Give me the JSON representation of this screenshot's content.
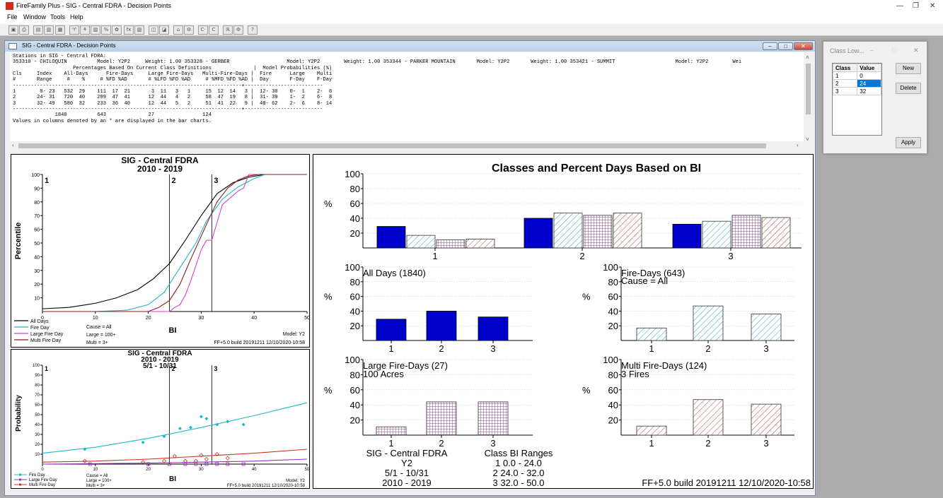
{
  "app": {
    "title": "FireFamily Plus - SIG - Central FDRA - Decision Points",
    "menu": [
      "File",
      "Window",
      "Tools",
      "Help"
    ],
    "toolbar_icons": [
      "save-icon",
      "print-icon",
      "export-icon",
      "copy-icon",
      "view-icon",
      "fire-icon",
      "chart-icon",
      "percent-icon",
      "weather-icon",
      "fx-icon",
      "table-icon",
      "bar-icon",
      "line-icon",
      "map-icon",
      "settings-icon",
      "class-icon",
      "class-edit-icon",
      "range-icon",
      "decision-icon",
      "decision-edit-icon",
      "help-icon"
    ],
    "toolbar_glyphs": [
      "▣",
      "⎙",
      "▤",
      "▥",
      "▦",
      "♈",
      "⚘",
      "▧",
      "%",
      "✿",
      "fx",
      "▨",
      "◫",
      "◪",
      "⌂",
      "⚙",
      "C·",
      "C",
      "ℝ",
      "Ф",
      "?"
    ]
  },
  "window": {
    "title": "SIG - Central FDRA - Decision Points",
    "controls": [
      "–",
      "□",
      "✕"
    ]
  },
  "report": {
    "lines": [
      "Stations in SIG - Central FDRA:",
      "353310 - CHILOQUIN          Model: Y2P2     Weight: 1.00 353328 - GERBER                   Model: Y2P2        Weight: 1.00 353344 - PARKER MOUNTAIN       Model: Y2P2       Weight: 1.00 353421 - SUMMIT                    Model: Y2P2        Wei",
      "                    Percentages Based On Current Class Definitions              |  Model Probabilities (%)",
      "Cls     Index    All-Days      Fire-Days     Large Fire-Days   Multi-Fire-Days |  Fire      Large    Multi",
      "#       Range     #    %     # %FD %AD       # %LFD %FD %AD     # %MFD %FD %AD |  Day       F-Day    F-Day",
      "----------------------------------------------------------------------------+--------------------------",
      "1        0- 23   532  29    111  17  21       3  11   3   1     15  12  14   3 |  12- 30    0-  1    2-  6",
      "2       24- 31   720  40    299  47  41      12  44   4   2     58  47  19   8 |  31- 39    1-  2    6-  8",
      "3       32- 49   580  32    233  36  40      12  44   5   2     51  41  22   9 |  40- 62    2-  6    8- 14",
      "----------------------------------------------------------------------------+--------------------------",
      "              1840          643              27                124",
      "Values in columns denoted by an * are displayed in the bar charts."
    ]
  },
  "percentile_chart": {
    "title": "SIG - Central FDRA",
    "subtitle": "2010 - 2019",
    "xlabel": "BI",
    "ylabel": "Percentile",
    "xticks": [
      "0",
      "10",
      "20",
      "30",
      "40",
      "50"
    ],
    "yticks": [
      "10",
      "20",
      "30",
      "40",
      "50",
      "60",
      "70",
      "80",
      "90",
      "100"
    ],
    "legend": [
      "All Days",
      "Fire Day",
      "Large Fire Day",
      "Multi Fire Day"
    ],
    "notes": [
      "Cause = All",
      "Large = 100+",
      "Multi = 3+"
    ],
    "model": "Model: Y2",
    "build": "FF+5.0 build 20191211 12/10/2020-10:58",
    "class_lines": [
      {
        "bi": 0,
        "label": "1"
      },
      {
        "bi": 24,
        "label": "2"
      },
      {
        "bi": 32,
        "label": "3"
      }
    ]
  },
  "probability_chart": {
    "title": "SIG - Central FDRA",
    "subtitle": "2010 - 2019",
    "period": "5/1 - 10/31",
    "xlabel": "BI",
    "ylabel": "Probability",
    "xticks": [
      "0",
      "10",
      "20",
      "30",
      "40",
      "50"
    ],
    "yticks": [
      "10",
      "20",
      "30",
      "40",
      "50",
      "60",
      "70",
      "80",
      "90",
      "100"
    ],
    "legend": [
      "Fire Day",
      "Large Fire Day",
      "Multi Fire Day"
    ],
    "notes": [
      "Cause = All",
      "Large = 100+",
      "Multi = 3+"
    ],
    "model": "Model: Y2",
    "build": "FF+5.0 build 20191211 12/10/2020-10:58"
  },
  "bar_panel": {
    "title": "Classes and Percent Days Based on BI",
    "pct": "%",
    "yticks": [
      "20",
      "40",
      "60",
      "80",
      "100"
    ],
    "classes": [
      "1",
      "2",
      "3"
    ],
    "subtitles": {
      "all": "All Days (1840)",
      "fire": "Fire-Days (643)",
      "fire2": "Cause = All",
      "large": "Large Fire-Days (27)",
      "large2": "100 Acres",
      "multi": "Multi Fire-Days (124)",
      "multi2": "3 Fires"
    },
    "footer": {
      "area": "SIG - Central FDRA",
      "model": "Y2",
      "period": "5/1 - 10/31",
      "years": "2010 - 2019",
      "ranges_title": "Class BI Ranges",
      "ranges": [
        "1  0.0 -  24.0",
        "2  24.0 -  32.0",
        "3  32.0 -  50.0"
      ],
      "build": "FF+5.0 build 20191211 12/10/2020-10:58"
    }
  },
  "class_window": {
    "title": "Class Low...",
    "controls": [
      "–",
      "□",
      "✕"
    ],
    "headers": [
      "Class",
      "Value"
    ],
    "rows": [
      [
        "1",
        "0"
      ],
      [
        "2",
        "24"
      ],
      [
        "3",
        "32"
      ]
    ],
    "buttons": {
      "new": "New",
      "delete": "Delete",
      "apply": "Apply"
    }
  },
  "chart_data": [
    {
      "type": "line",
      "title": "SIG - Central FDRA",
      "xlabel": "BI",
      "ylabel": "Percentile",
      "xlim": [
        0,
        50
      ],
      "ylim": [
        0,
        100
      ],
      "series": [
        {
          "name": "All Days",
          "color": "#000000",
          "x": [
            0,
            5,
            10,
            14,
            18,
            21,
            24,
            27,
            30,
            33,
            36,
            39,
            42,
            45,
            50
          ],
          "y": [
            2,
            3,
            6,
            10,
            16,
            24,
            35,
            52,
            70,
            86,
            94,
            98,
            100,
            100,
            100
          ]
        },
        {
          "name": "Fire Day",
          "color": "#1fb7c9",
          "x": [
            0,
            10,
            16,
            20,
            23,
            26,
            29,
            31,
            34,
            37,
            40,
            42,
            45,
            50
          ],
          "y": [
            0,
            0,
            1,
            5,
            14,
            32,
            50,
            66,
            82,
            91,
            97,
            100,
            100,
            100
          ]
        },
        {
          "name": "Large Fire Day",
          "color": "#d43fd4",
          "x": [
            0,
            18,
            22,
            24,
            25,
            26,
            27,
            28,
            30,
            31,
            32,
            33,
            34,
            37,
            38,
            39,
            40,
            50
          ],
          "y": [
            0,
            0,
            0,
            0,
            3,
            5,
            12,
            22,
            45,
            52,
            52,
            65,
            78,
            88,
            90,
            100,
            100,
            100
          ]
        },
        {
          "name": "Multi Fire Day",
          "color": "#8b1a1a",
          "x": [
            0,
            20,
            22,
            24,
            26,
            28,
            30,
            32,
            33,
            35,
            37,
            39,
            41,
            45,
            50
          ],
          "y": [
            0,
            0,
            3,
            8,
            20,
            38,
            55,
            72,
            80,
            90,
            96,
            99,
            100,
            100,
            100
          ]
        }
      ]
    },
    {
      "type": "scatter",
      "title": "SIG - Central FDRA",
      "xlabel": "BI",
      "ylabel": "Probability",
      "xlim": [
        0,
        50
      ],
      "ylim": [
        0,
        100
      ],
      "series": [
        {
          "name": "Fire Day",
          "color": "#1fb7c9",
          "points": [
            [
              8,
              15
            ],
            [
              19,
              22
            ],
            [
              23,
              28
            ],
            [
              26,
              36
            ],
            [
              28,
              37
            ],
            [
              30,
              48
            ],
            [
              31,
              46
            ],
            [
              33,
              40
            ],
            [
              35,
              43
            ],
            [
              38,
              40
            ]
          ],
          "fit": [
            [
              0,
              11
            ],
            [
              10,
              17
            ],
            [
              20,
              26
            ],
            [
              30,
              37
            ],
            [
              40,
              49
            ],
            [
              50,
              62
            ]
          ]
        },
        {
          "name": "Large Fire Day",
          "color": "#9b2fbf",
          "points": [
            [
              9,
              0
            ],
            [
              20,
              0
            ],
            [
              24,
              0
            ],
            [
              27,
              0
            ],
            [
              29,
              0
            ],
            [
              31,
              0
            ],
            [
              33,
              0
            ],
            [
              35,
              0
            ],
            [
              38,
              0
            ]
          ],
          "fit": [
            [
              0,
              0
            ],
            [
              20,
              1
            ],
            [
              30,
              2
            ],
            [
              40,
              3
            ],
            [
              50,
              5
            ]
          ]
        },
        {
          "name": "Multi Fire Day",
          "color": "#c0392b",
          "points": [
            [
              8,
              3
            ],
            [
              19,
              2
            ],
            [
              23,
              3
            ],
            [
              25,
              8
            ],
            [
              27,
              3
            ],
            [
              29,
              3
            ],
            [
              30,
              9
            ],
            [
              31,
              5
            ],
            [
              33,
              10
            ],
            [
              35,
              6
            ]
          ],
          "fit": [
            [
              0,
              2
            ],
            [
              10,
              3
            ],
            [
              20,
              5
            ],
            [
              30,
              8
            ],
            [
              40,
              11
            ],
            [
              50,
              15
            ]
          ]
        }
      ]
    },
    {
      "type": "bar",
      "title": "Classes and Percent Days Based on BI",
      "categories": [
        "1",
        "2",
        "3"
      ],
      "ylim": [
        0,
        100
      ],
      "series": [
        {
          "name": "All Days (1840)",
          "values": [
            29,
            40,
            32
          ]
        },
        {
          "name": "Fire-Days (643)",
          "values": [
            17,
            47,
            36
          ]
        },
        {
          "name": "Large Fire-Days (27)",
          "values": [
            11,
            44,
            44
          ]
        },
        {
          "name": "Multi Fire-Days (124)",
          "values": [
            12,
            47,
            41
          ]
        }
      ]
    }
  ]
}
